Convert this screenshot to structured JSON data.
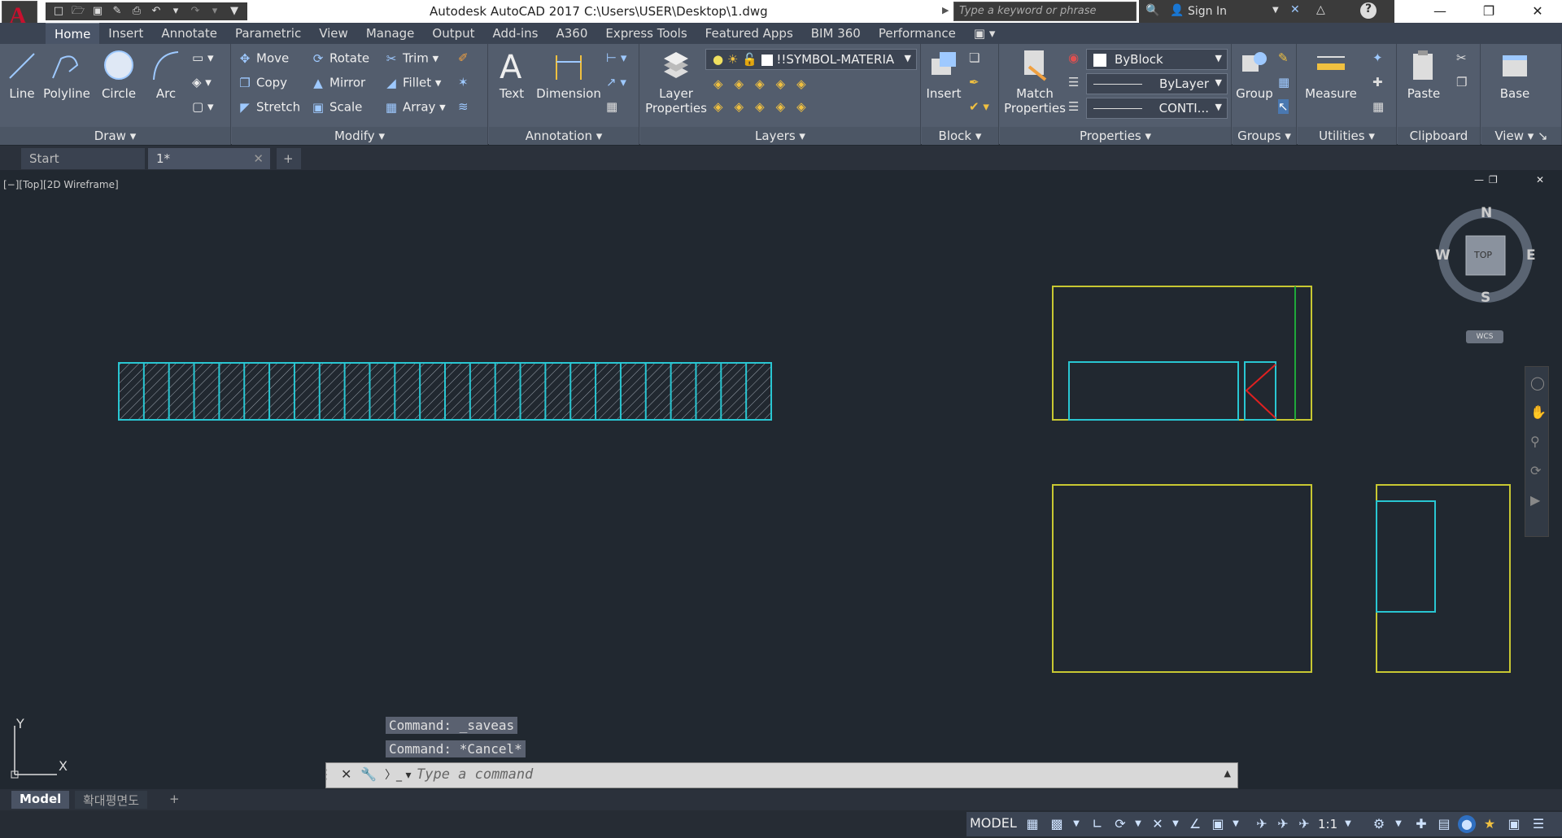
{
  "titlebar": {
    "app_title": "Autodesk AutoCAD 2017",
    "file_path": "C:\\Users\\USER\\Desktop\\1.dwg",
    "search_placeholder": "Type a keyword or phrase",
    "sign_in": "Sign In"
  },
  "ribbon_tabs": [
    "Home",
    "Insert",
    "Annotate",
    "Parametric",
    "View",
    "Manage",
    "Output",
    "Add-ins",
    "A360",
    "Express Tools",
    "Featured Apps",
    "BIM 360",
    "Performance"
  ],
  "ribbon": {
    "draw": {
      "title": "Draw",
      "line": "Line",
      "polyline": "Polyline",
      "circle": "Circle",
      "arc": "Arc"
    },
    "modify": {
      "title": "Modify",
      "move": "Move",
      "rotate": "Rotate",
      "trim": "Trim",
      "copy": "Copy",
      "mirror": "Mirror",
      "fillet": "Fillet",
      "stretch": "Stretch",
      "scale": "Scale",
      "array": "Array"
    },
    "annotation": {
      "title": "Annotation",
      "text": "Text",
      "dimension": "Dimension"
    },
    "layers": {
      "title": "Layers",
      "layer_properties": "Layer Properties",
      "layer_combo": "!!SYMBOL-MATERIA"
    },
    "block": {
      "title": "Block",
      "insert": "Insert"
    },
    "properties": {
      "title": "Properties",
      "match": "Match Properties",
      "color": "ByBlock",
      "linetype": "ByLayer",
      "lineweight": "CONTI..."
    },
    "groups": {
      "title": "Groups",
      "group": "Group"
    },
    "utilities": {
      "title": "Utilities",
      "measure": "Measure"
    },
    "clipboard": {
      "title": "Clipboard",
      "paste": "Paste"
    },
    "view": {
      "title": "View",
      "base": "Base"
    }
  },
  "doc_tabs": {
    "start": "Start",
    "current": "1*"
  },
  "viewport": {
    "label": "[−][Top][2D Wireframe]"
  },
  "viewcube": {
    "n": "N",
    "s": "S",
    "e": "E",
    "w": "W",
    "top": "TOP",
    "wcs": "WCS"
  },
  "ucs": {
    "x": "X",
    "y": "Y"
  },
  "command": {
    "history": [
      "Command: _saveas",
      "Command: *Cancel*"
    ],
    "placeholder": "Type a command"
  },
  "layout_tabs": [
    "Model",
    "확대평면도"
  ],
  "status": {
    "model": "MODEL",
    "scale": "1:1"
  },
  "colors": {
    "cyan": "#29c6d2",
    "yellow": "#c8c832",
    "red": "#e02020",
    "green": "#1fa83a"
  }
}
